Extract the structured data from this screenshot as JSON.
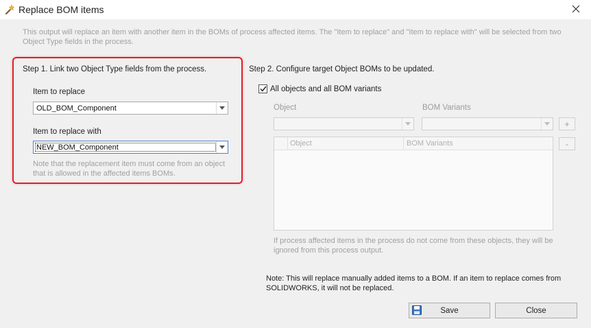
{
  "window": {
    "title": "Replace BOM items",
    "app_icon": "magic-wand-icon",
    "close_icon": "close-icon"
  },
  "intro": "This output will replace an item with another item in the BOMs of process affected items. The \"Item to replace\" and \"Item to replace with\" will be selected from two Object Type fields in the process.",
  "step1": {
    "title": "Step 1. Link two Object Type fields from the process.",
    "item_to_replace_label": "Item to replace",
    "item_to_replace_value": "OLD_BOM_Component",
    "item_to_replace_with_label": "Item to replace with",
    "item_to_replace_with_value": "NEW_BOM_Component",
    "note": "Note that the replacement item must come from an object that is allowed in the affected items BOMs."
  },
  "step2": {
    "title": "Step 2. Configure target Object BOMs to be updated.",
    "all_objects_label": "All objects and all BOM variants",
    "all_objects_checked": true,
    "object_label": "Object",
    "bom_variants_label": "BOM Variants",
    "add_button": "+",
    "remove_button": "-",
    "grid_columns": [
      "Object",
      "BOM Variants"
    ],
    "info": "If process affected items in the process do not come from these objects, they will be ignored from this process output."
  },
  "footer_note": "Note: This will replace manually added items to a BOM. If an item to replace comes from SOLIDWORKS, it will not be replaced.",
  "buttons": {
    "save": "Save",
    "save_icon": "floppy-disk-icon",
    "close": "Close"
  },
  "colors": {
    "highlight": "#e0202a",
    "focus": "#4a7fd0",
    "disabled_text": "#a0a0a0"
  }
}
